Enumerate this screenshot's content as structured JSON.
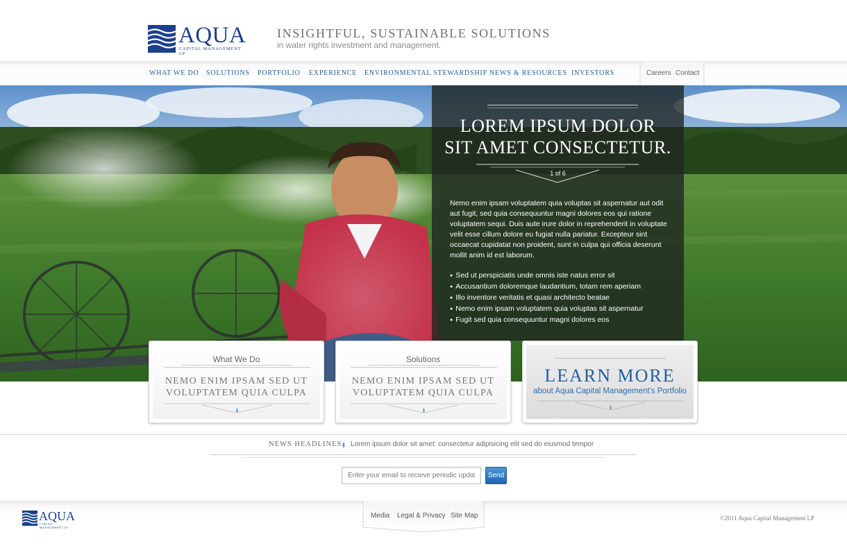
{
  "brand": {
    "logo_word": "AQUA",
    "logo_sub": "Capital Management LP",
    "color": "#1c3f8c"
  },
  "header": {
    "tagline": "INSIGHTFUL, SUSTAINABLE SOLUTIONS",
    "tagline_sub": "in water rights investment and management."
  },
  "nav": {
    "items": [
      {
        "label": "What We Do"
      },
      {
        "label": "Solutions"
      },
      {
        "label": "Portfolio"
      },
      {
        "label": "Experience"
      },
      {
        "label": "Environmental Stewardship"
      },
      {
        "label": "News & Resources"
      },
      {
        "label": "Investors"
      }
    ],
    "utility": [
      {
        "label": "Careers"
      },
      {
        "label": "Contact"
      }
    ],
    "link_color": "#1e5fa0"
  },
  "hero": {
    "title_line1": "LOREM IPSUM DOLOR",
    "title_line2": "SIT AMET CONSECTETUR.",
    "counter": "1 of 6",
    "body": "Nemo enim ipsam voluptatem quia voluptas sit aspernatur aut odit aut fugit, sed quia consequuntur magni dolores eos qui ratione voluptatem sequi. Duis aute irure dolor in reprehenderit in voluptate velit esse cillum dolore eu fugiat nulla pariatur. Excepteur sint occaecat cupidatat non proident, sunt in culpa qui officia deserunt mollit anim id est laborum.",
    "bullets": [
      "Sed ut perspiciatis unde omnis iste natus error sit",
      "Accusantium doloremque laudantium, totam rem aperiam",
      "Illo inventore veritatis et quasi architecto beatae",
      "Nemo enim ipsam voluptatem quia voluptas sit aspernatur",
      "Fugit sed quia consequuntur magni dolores eos"
    ]
  },
  "cards": [
    {
      "title": "What We Do",
      "text_line1": "NEMO ENIM IPSAM SED UT",
      "text_line2": "VOLUPTATEM QUIA CULPA"
    },
    {
      "title": "Solutions",
      "text_line1": "NEMO ENIM IPSAM SED UT",
      "text_line2": "VOLUPTATEM QUIA CULPA"
    }
  ],
  "learn_more": {
    "big": "LEARN MORE",
    "sub": "about Aqua Capital Management's Portfolio"
  },
  "news": {
    "label": "News Headlines",
    "headline": "Lorem ipsum dolor sit amet: consectetur adipisicing elit sed do eiusmod tempor"
  },
  "signup": {
    "placeholder": "Enter your email to recieve periodic updates.",
    "button": "Send"
  },
  "footer": {
    "links": [
      {
        "label": "Media"
      },
      {
        "label": "Legal & Privacy"
      },
      {
        "label": "Site Map"
      }
    ],
    "copyright": "©2011 Aqua Capital Management LP"
  },
  "icons": {
    "drop": "water-drop-icon",
    "bullet": "bullet-dot"
  },
  "colors": {
    "accent": "#1e5fa0",
    "panel": "#1e2420",
    "button": "#2a74bd"
  }
}
